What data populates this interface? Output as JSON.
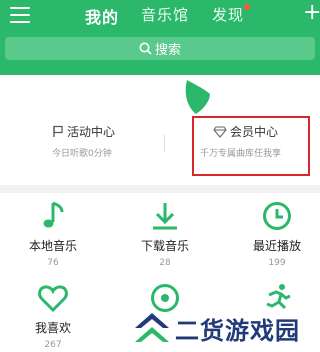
{
  "header": {
    "tabs": [
      {
        "label": "我的",
        "active": true
      },
      {
        "label": "音乐馆",
        "active": false
      },
      {
        "label": "发现",
        "active": false,
        "badge": true
      }
    ],
    "search_label": "搜索",
    "accent": "#2bb86a",
    "badge_color": "#ff5a3c"
  },
  "card": {
    "activity": {
      "title": "活动中心",
      "subtitle": "今日听歌0分钟",
      "icon": "flag-icon"
    },
    "vip": {
      "title": "会员中心",
      "subtitle": "千万专属曲库任我享",
      "icon": "diamond-icon",
      "highlight_color": "#d9262c"
    }
  },
  "grid": [
    {
      "label": "本地音乐",
      "count": "76",
      "icon": "music-note-icon"
    },
    {
      "label": "下载音乐",
      "count": "28",
      "icon": "download-icon"
    },
    {
      "label": "最近播放",
      "count": "199",
      "icon": "clock-icon"
    },
    {
      "label": "我喜欢",
      "count": "267",
      "icon": "heart-icon"
    },
    {
      "label": "",
      "count": "",
      "icon": "radio-icon"
    },
    {
      "label": "",
      "count": "",
      "icon": "running-icon"
    }
  ],
  "watermark": {
    "text": "二货游戏园",
    "icon": "double-chevron-logo"
  }
}
